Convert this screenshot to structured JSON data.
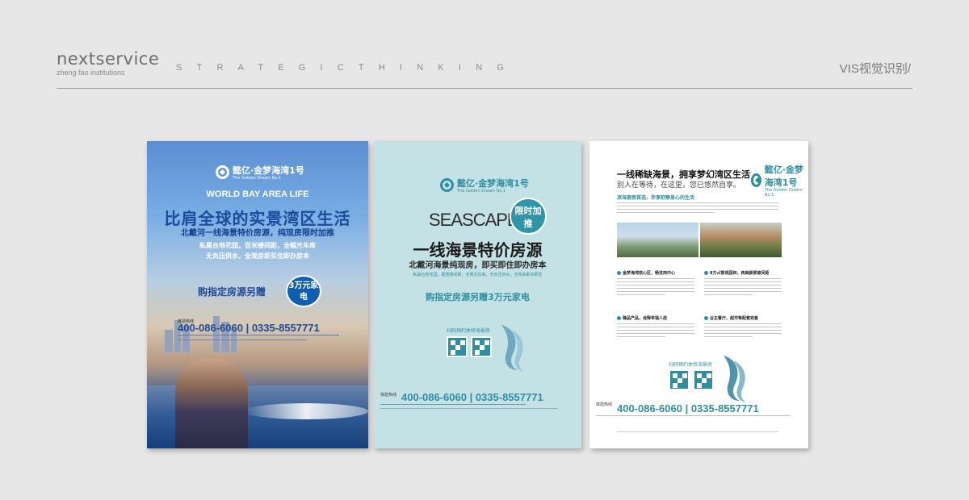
{
  "header": {
    "brand": "nextservice",
    "brand_sub": "zheng fao institutions",
    "tagline": "STRATEGICTHINKING",
    "section": "VIS视觉识别/"
  },
  "poster1": {
    "logo": "懿亿·金梦海湾1号",
    "logo_en": "The Golden Dream No.1",
    "eyebrow": "WORLD BAY AREA LIFE",
    "headline": "比肩全球的实景湾区生活",
    "subline": "北戴河一线海景特价房源，纯现房限时加推",
    "bullet1": "私属台地花园，百米楼间距，全幅光车库",
    "bullet2": "无负压供水，全现房即买住即办房本",
    "offer": "购指定房源另赠",
    "badge": "3万元家电",
    "hotline_label": "体验热线",
    "hotline": "400-086-6060 | 0335-8557771"
  },
  "poster2": {
    "logo": "懿亿·金梦海湾1号",
    "logo_en": "The Golden Dream No.1",
    "seascape": "SEASCAPE",
    "limited": "限时加推",
    "headline": "一线海景特价房源",
    "subline": "北戴河海景纯现房，即买即住即办房本",
    "features": "私属台地花园，超宽楼间距，全阳光车库，无负压供水，全现房即买即住",
    "offer": "购指定房源另赠3万元家电",
    "scan": "扫码预约体验海景房",
    "hotline_label": "体验热线",
    "hotline": "400-086-6060 | 0335-8557771"
  },
  "poster3": {
    "logo": "懿亿·金梦海湾1号",
    "logo_en": "The Golden Dream No.1",
    "title": "一线稀缺海景，拥享梦幻湾区生活",
    "subtitle": "别人在等待，在这里，您已悠然自享。",
    "section1": "滨海度假首选，伴享舒静身心的生活",
    "c1": "金梦海湾核心区，畅览西中心",
    "c2": "8万㎡景观园林，西美颜景被间距",
    "c3": "臻品产品，诠释幸福人居",
    "c4": "业主餐厅、超市等配套完备",
    "scan": "扫码预约体验海景房",
    "hotline_label": "体验热线",
    "hotline": "400-086-6060 | 0335-8557771"
  },
  "colors": {
    "accent": "#2f8ea1",
    "navy": "#1d4b9a",
    "background": "#e7e7e7"
  }
}
